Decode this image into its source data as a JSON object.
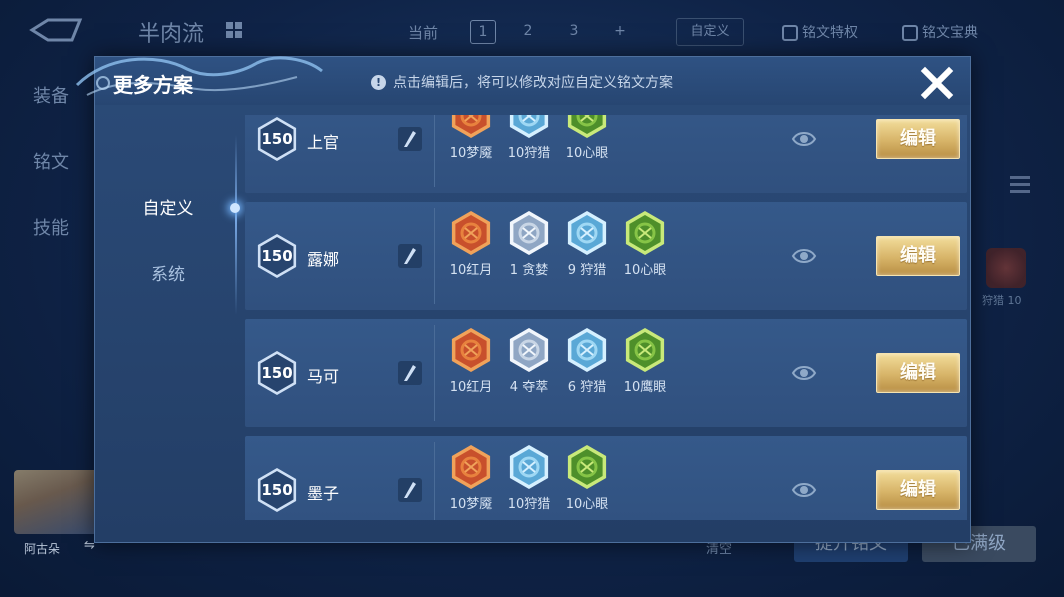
{
  "background": {
    "title": "半肉流",
    "current_label": "当前",
    "pages": [
      "1",
      "2",
      "3",
      "+"
    ],
    "custom_label": "自定义",
    "rune_privilege": "铭文特权",
    "rune_codex": "铭文宝典",
    "side_tabs": [
      "装备",
      "铭文",
      "技能"
    ],
    "hero_name": "阿古朵",
    "swap_symbol": "⇋",
    "reset_label": "清空",
    "bottom_left_button": "提升铭文",
    "bottom_right_button": "已满级",
    "right_rune_caption": "狩猎 10"
  },
  "modal": {
    "title": "更多方案",
    "notice": "点击编辑后，将可以修改对应自定义铭文方案",
    "notice_icon": "!",
    "close_icon": "close-icon"
  },
  "sidebar": {
    "tabs": [
      {
        "label": "自定义",
        "active": true
      },
      {
        "label": "系统",
        "active": false
      }
    ]
  },
  "plans": [
    {
      "level": "150",
      "name": "上官",
      "edit_label": "编辑",
      "runes": [
        {
          "label": "10梦魇",
          "kind": "red"
        },
        {
          "label": "10狩猎",
          "kind": "blue"
        },
        {
          "label": "10心眼",
          "kind": "green"
        }
      ]
    },
    {
      "level": "150",
      "name": "露娜",
      "edit_label": "编辑",
      "runes": [
        {
          "label": "10红月",
          "kind": "red"
        },
        {
          "label": "1 贪婪",
          "kind": "silver"
        },
        {
          "label": "9 狩猎",
          "kind": "blue"
        },
        {
          "label": "10心眼",
          "kind": "green"
        }
      ]
    },
    {
      "level": "150",
      "name": "马可",
      "edit_label": "编辑",
      "runes": [
        {
          "label": "10红月",
          "kind": "red"
        },
        {
          "label": "4 夺萃",
          "kind": "silver"
        },
        {
          "label": "6 狩猎",
          "kind": "blue"
        },
        {
          "label": "10鹰眼",
          "kind": "green"
        }
      ]
    },
    {
      "level": "150",
      "name": "墨子",
      "edit_label": "编辑",
      "runes": [
        {
          "label": "10梦魇",
          "kind": "red"
        },
        {
          "label": "10狩猎",
          "kind": "blue"
        },
        {
          "label": "10心眼",
          "kind": "green"
        }
      ]
    }
  ],
  "colors": {
    "rune_red": "#c8502c",
    "rune_blue": "#7fc3e6",
    "rune_green": "#6fae3a",
    "rune_silver": "#c9d6e6",
    "edit_gold": "#d7b468"
  }
}
